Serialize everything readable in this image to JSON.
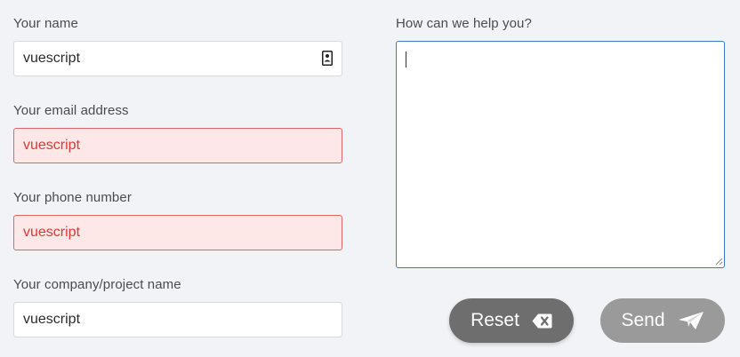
{
  "form": {
    "name": {
      "label": "Your name",
      "value": "vuescript",
      "state": "normal",
      "icon": "contact-card-icon"
    },
    "email": {
      "label": "Your email address",
      "value": "vuescript",
      "state": "error"
    },
    "phone": {
      "label": "Your phone number",
      "value": "vuescript",
      "state": "error"
    },
    "company": {
      "label": "Your company/project name",
      "value": "vuescript",
      "state": "normal"
    },
    "message": {
      "label": "How can we help you?",
      "value": "",
      "state": "focused"
    }
  },
  "buttons": {
    "reset": {
      "label": "Reset",
      "icon": "backspace-icon"
    },
    "send": {
      "label": "Send",
      "icon": "paper-plane-icon",
      "state": "disabled"
    }
  },
  "colors": {
    "background": "#f2f3f7",
    "error_bg": "#fde7e7",
    "error_border": "#e06666",
    "error_text": "#d93a3a",
    "focus_border": "#3b7bbf",
    "reset_button": "#6e6e6e",
    "send_button": "#9a9a9a"
  }
}
